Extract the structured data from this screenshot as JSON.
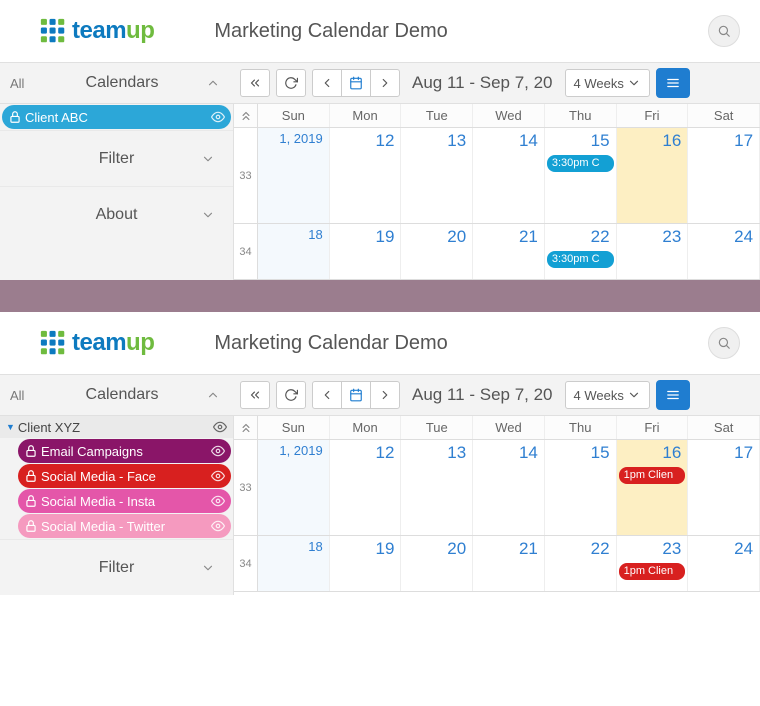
{
  "views": [
    {
      "title": "Marketing Calendar Demo",
      "sidebar": {
        "all": "All",
        "label": "Calendars",
        "items": [
          {
            "name": "Client ABC",
            "color": "#2ca7d8",
            "indent": 0
          }
        ],
        "sections": [
          "Filter",
          "About"
        ],
        "group_header": null
      },
      "toolbar": {
        "range": "Aug 11 - Sep 7, 20",
        "view": "4 Weeks"
      },
      "dow": [
        "Sun",
        "Mon",
        "Tue",
        "Wed",
        "Thu",
        "Fri",
        "Sat"
      ],
      "weeks": [
        {
          "num": "33",
          "short": false,
          "days": [
            {
              "label": "1, 2019",
              "mon": true
            },
            {
              "label": "12"
            },
            {
              "label": "13"
            },
            {
              "label": "14"
            },
            {
              "label": "15",
              "events": [
                {
                  "text": "3:30pm C",
                  "color": "#13a0d4"
                }
              ]
            },
            {
              "label": "16",
              "today": true
            },
            {
              "label": "17"
            }
          ]
        },
        {
          "num": "34",
          "short": true,
          "days": [
            {
              "label": "18",
              "mon": true
            },
            {
              "label": "19"
            },
            {
              "label": "20"
            },
            {
              "label": "21"
            },
            {
              "label": "22",
              "events": [
                {
                  "text": "3:30pm C",
                  "color": "#13a0d4"
                }
              ]
            },
            {
              "label": "23"
            },
            {
              "label": "24"
            }
          ]
        }
      ]
    },
    {
      "title": "Marketing Calendar Demo",
      "sidebar": {
        "all": "All",
        "label": "Calendars",
        "group_header": "Client XYZ",
        "items": [
          {
            "name": "Email Campaigns",
            "color": "#8a1568",
            "indent": 1
          },
          {
            "name": "Social Media - Face",
            "color": "#d8201f",
            "indent": 1
          },
          {
            "name": "Social Media - Insta",
            "color": "#e456a9",
            "indent": 1
          },
          {
            "name": "Social Media - Twitter",
            "color": "#f59abf",
            "indent": 1
          }
        ],
        "sections": [
          "Filter"
        ]
      },
      "toolbar": {
        "range": "Aug 11 - Sep 7, 20",
        "view": "4 Weeks"
      },
      "dow": [
        "Sun",
        "Mon",
        "Tue",
        "Wed",
        "Thu",
        "Fri",
        "Sat"
      ],
      "weeks": [
        {
          "num": "33",
          "short": false,
          "days": [
            {
              "label": "1, 2019",
              "mon": true
            },
            {
              "label": "12"
            },
            {
              "label": "13"
            },
            {
              "label": "14"
            },
            {
              "label": "15"
            },
            {
              "label": "16",
              "today": true,
              "events": [
                {
                  "text": "1pm Clien",
                  "color": "#d8201f"
                }
              ]
            },
            {
              "label": "17"
            }
          ]
        },
        {
          "num": "34",
          "short": true,
          "days": [
            {
              "label": "18",
              "mon": true
            },
            {
              "label": "19"
            },
            {
              "label": "20"
            },
            {
              "label": "21"
            },
            {
              "label": "22"
            },
            {
              "label": "23",
              "events": [
                {
                  "text": "1pm Clien",
                  "color": "#d8201f"
                }
              ]
            },
            {
              "label": "24"
            }
          ]
        }
      ]
    }
  ]
}
